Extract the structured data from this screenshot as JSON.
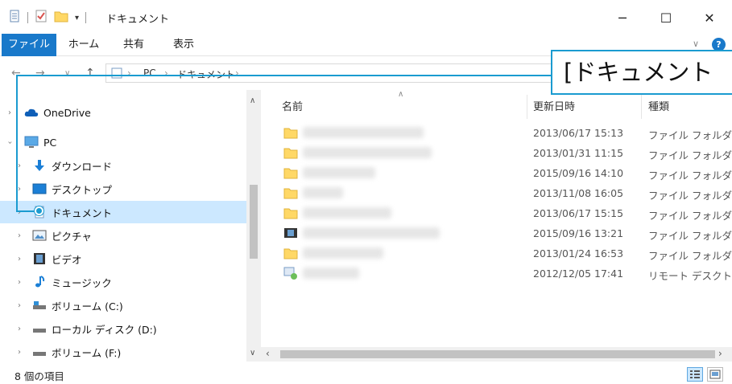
{
  "window": {
    "title": "ドキュメント",
    "minimize": "─",
    "maximize": "☐",
    "close": "✕"
  },
  "ribbon": {
    "tabs": [
      "ファイル",
      "ホーム",
      "共有",
      "表示"
    ]
  },
  "address": {
    "segments": [
      "PC",
      "ドキュメント"
    ]
  },
  "callout": {
    "text": "[ドキュメント"
  },
  "nav": {
    "items": [
      {
        "label": "OneDrive",
        "icon": "cloud-icon"
      },
      {
        "label": "PC",
        "icon": "computer-icon"
      },
      {
        "label": "ダウンロード",
        "icon": "download-icon"
      },
      {
        "label": "デスクトップ",
        "icon": "desktop-icon"
      },
      {
        "label": "ドキュメント",
        "icon": "document-icon"
      },
      {
        "label": "ピクチャ",
        "icon": "picture-icon"
      },
      {
        "label": "ビデオ",
        "icon": "video-icon"
      },
      {
        "label": "ミュージック",
        "icon": "music-icon"
      },
      {
        "label": "ボリューム (C:)",
        "icon": "drive-icon"
      },
      {
        "label": "ローカル ディスク (D:)",
        "icon": "drive-icon"
      },
      {
        "label": "ボリューム (F:)",
        "icon": "drive-icon"
      }
    ]
  },
  "list": {
    "columns": {
      "name": "名前",
      "date": "更新日時",
      "type": "種類"
    },
    "rows": [
      {
        "date": "2013/06/17 15:13",
        "type": "ファイル フォルダー",
        "icon": "folder-icon"
      },
      {
        "date": "2013/01/31 11:15",
        "type": "ファイル フォルダー",
        "icon": "folder-icon"
      },
      {
        "date": "2015/09/16 14:10",
        "type": "ファイル フォルダー",
        "icon": "folder-icon"
      },
      {
        "date": "2013/11/08 16:05",
        "type": "ファイル フォルダー",
        "icon": "folder-icon"
      },
      {
        "date": "2013/06/17 15:15",
        "type": "ファイル フォルダー",
        "icon": "folder-icon"
      },
      {
        "date": "2015/09/16 13:21",
        "type": "ファイル フォルダー",
        "icon": "folder-icon"
      },
      {
        "date": "2013/01/24 16:53",
        "type": "ファイル フォルダー",
        "icon": "folder-icon"
      },
      {
        "date": "2012/12/05 17:41",
        "type": "リモート デスクトップ",
        "icon": "remote-desktop-icon"
      }
    ]
  },
  "status": {
    "count": "8 個の項目"
  },
  "colors": {
    "accent": "#1979ca",
    "callout": "#1a9bd0",
    "selected": "#cce8ff",
    "folder": "#ffd866"
  }
}
